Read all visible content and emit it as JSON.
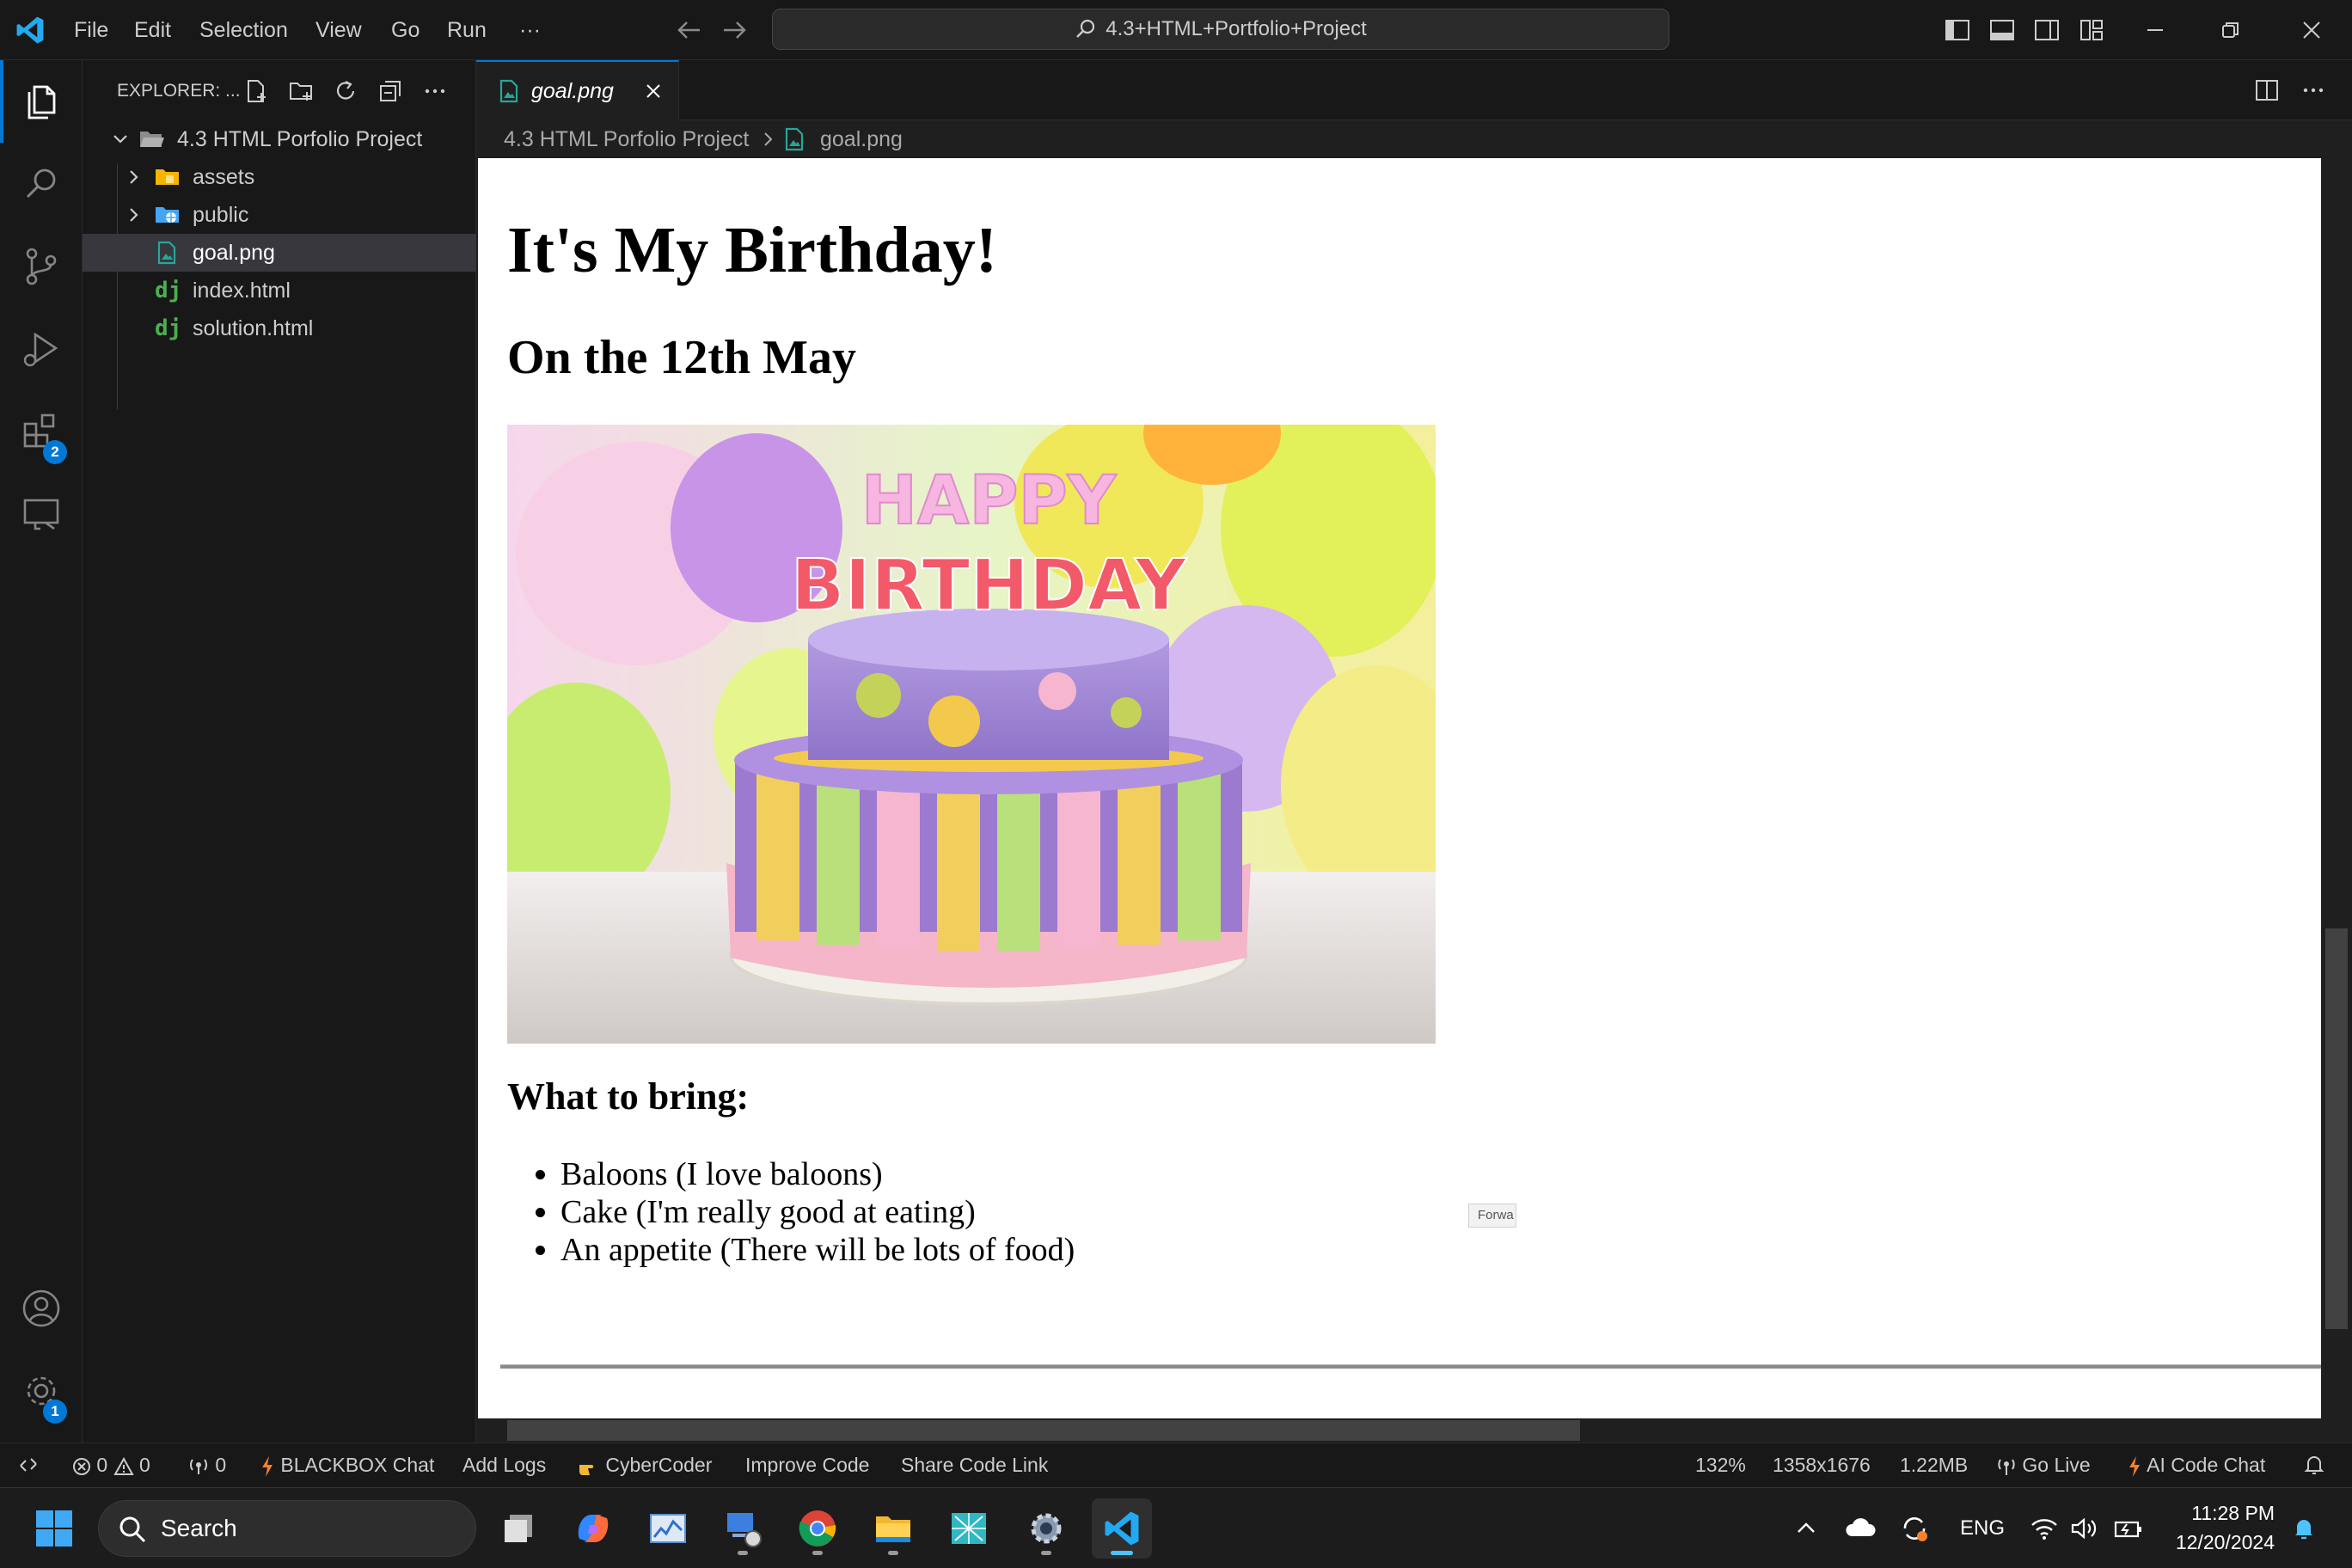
{
  "titlebar": {
    "menu": [
      "File",
      "Edit",
      "Selection",
      "View",
      "Go",
      "Run"
    ],
    "more": "···",
    "command_center": "4.3+HTML+Portfolio+Project"
  },
  "activitybar": {
    "extensions_badge": "2",
    "manage_badge": "1"
  },
  "sidebar": {
    "title": "EXPLORER: ...",
    "project": "4.3 HTML Porfolio Project",
    "items": [
      {
        "label": "assets",
        "kind": "folder"
      },
      {
        "label": "public",
        "kind": "folder"
      },
      {
        "label": "goal.png",
        "kind": "image",
        "selected": true
      },
      {
        "label": "index.html",
        "kind": "django-html"
      },
      {
        "label": "solution.html",
        "kind": "django-html"
      }
    ]
  },
  "editor": {
    "tab_label": "goal.png",
    "breadcrumb": [
      "4.3 HTML Porfolio Project",
      "goal.png"
    ]
  },
  "preview": {
    "h1": "It's My Birthday!",
    "h2": "On the 12th May",
    "cake_candles": "HAPPY BIRTHDAY",
    "h3": "What to bring:",
    "list": [
      "Baloons (I love baloons)",
      "Cake (I'm really good at eating)",
      "An appetite (There will be lots of food)"
    ],
    "tooltip_fragment": "Forwa"
  },
  "statusbar": {
    "errors": "0",
    "warnings": "0",
    "ports": "0",
    "items": [
      "BLACKBOX Chat",
      "Add Logs",
      "CyberCoder",
      "Improve Code",
      "Share Code Link"
    ],
    "zoom": "132%",
    "dimensions": "1358x1676",
    "file_size": "1.22MB",
    "go_live": "Go Live",
    "ai_chat": "AI Code Chat"
  },
  "taskbar": {
    "search_label": "Search",
    "language": "ENG",
    "time": "11:28 PM",
    "date": "12/20/2024"
  },
  "colors": {
    "accent": "#0078d4",
    "editor_bg": "#1f1f1f",
    "chrome_bg": "#181818"
  }
}
